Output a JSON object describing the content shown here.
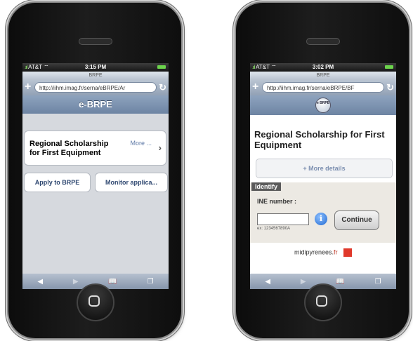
{
  "phone1": {
    "status": {
      "carrier": "AT&T",
      "time": "3:15 PM"
    },
    "tab_title": "BRPE",
    "url": "http://iihm.imag.fr/serna/eBRPE/Ar",
    "header_title": "e-BRPE",
    "card": {
      "title": "Regional Scholarship for First Equipment",
      "more": "More ..."
    },
    "buttons": [
      {
        "label": "Apply to BRPE"
      },
      {
        "label": "Monitor applica..."
      }
    ]
  },
  "phone2": {
    "status": {
      "carrier": "AT&T",
      "time": "3:02 PM"
    },
    "tab_title": "BRPE",
    "url": "http://iihm.imag.fr/serna/eBRPE/BF",
    "logo_text": "e BRPE",
    "title": "Regional Scholarship for First Equipment",
    "more_details": "+ More details",
    "identify": {
      "section_label": "Identify",
      "field_label": "INE number :",
      "hint": "ex: 1234567890A",
      "info": "i",
      "continue_label": "Continue"
    },
    "footer": {
      "brand": "midipyrenees.",
      "suffix": "fr"
    }
  },
  "icons": {
    "back": "◀",
    "forward": "▶",
    "bookmarks": "bookmarks-icon",
    "pages": "pages-icon"
  }
}
